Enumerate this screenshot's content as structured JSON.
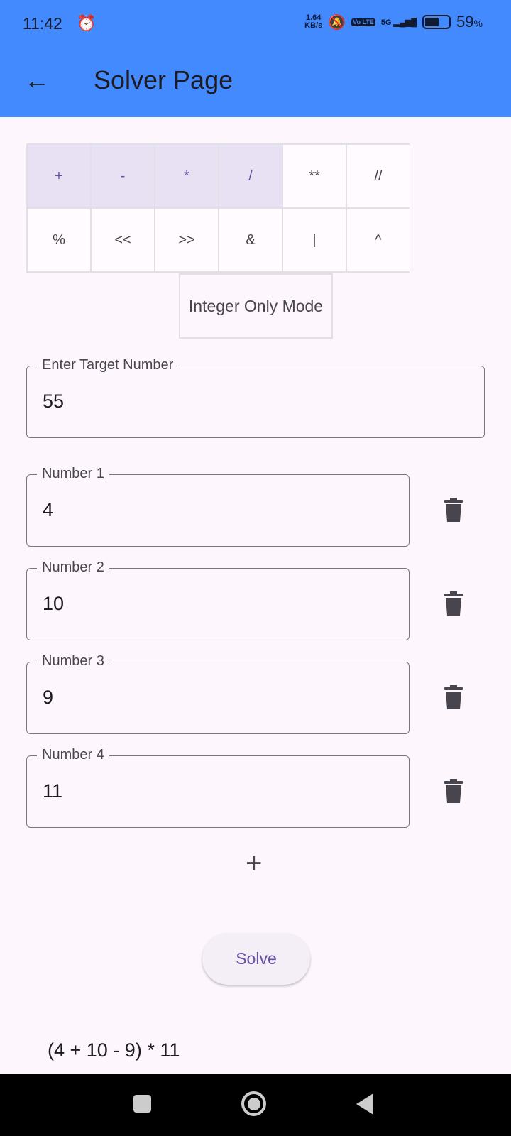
{
  "status": {
    "time": "11:42",
    "speed_value": "1.64",
    "speed_unit": "KB/s",
    "network": "5G",
    "volte": "Vo LTE",
    "battery": "59",
    "battery_unit": "%",
    "battery_level": 0.59
  },
  "appbar": {
    "title": "Solver Page"
  },
  "operators": [
    {
      "label": "+",
      "selected": true
    },
    {
      "label": "-",
      "selected": true
    },
    {
      "label": "*",
      "selected": true
    },
    {
      "label": "/",
      "selected": true
    },
    {
      "label": "**",
      "selected": false
    },
    {
      "label": "//",
      "selected": false
    },
    {
      "label": "%",
      "selected": false
    },
    {
      "label": "<<",
      "selected": false
    },
    {
      "label": ">>",
      "selected": false
    },
    {
      "label": "&",
      "selected": false
    },
    {
      "label": "|",
      "selected": false
    },
    {
      "label": "^",
      "selected": false
    }
  ],
  "integer_mode_label": "Integer Only Mode",
  "target": {
    "label": "Enter Target Number",
    "value": "55"
  },
  "numbers": [
    {
      "label": "Number 1",
      "value": "4"
    },
    {
      "label": "Number 2",
      "value": "10"
    },
    {
      "label": "Number 3",
      "value": "9"
    },
    {
      "label": "Number 4",
      "value": "11"
    }
  ],
  "add_label": "+",
  "solve_label": "Solve",
  "result": "(4 + 10 - 9) * 11",
  "colors": {
    "appbar": "#448aff",
    "accent": "#6750a4",
    "selected_bg": "#e8e0f3"
  }
}
